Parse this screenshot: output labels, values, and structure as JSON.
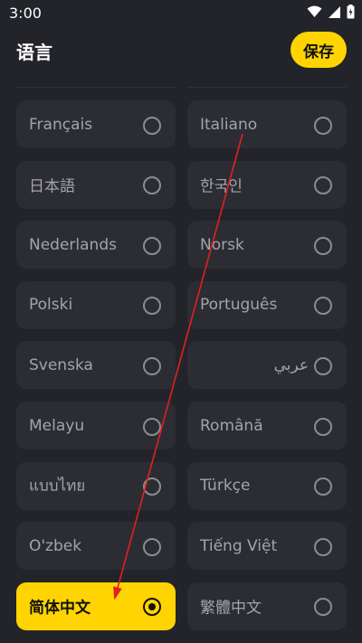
{
  "status_bar": {
    "time": "3:00",
    "icons": [
      "wifi-icon",
      "signal-icon",
      "battery-icon"
    ]
  },
  "header": {
    "title": "语言",
    "save_label": "保存"
  },
  "colors": {
    "background": "#232429",
    "item_background": "#2c2d33",
    "accent": "#ffd400",
    "annotation_arrow": "#e02020"
  },
  "languages": [
    {
      "label": "Français",
      "selected": false
    },
    {
      "label": "Italiano",
      "selected": false
    },
    {
      "label": "日本語",
      "selected": false
    },
    {
      "label": "한국인",
      "selected": false
    },
    {
      "label": "Nederlands",
      "selected": false
    },
    {
      "label": "Norsk",
      "selected": false
    },
    {
      "label": "Polski",
      "selected": false
    },
    {
      "label": "Português",
      "selected": false
    },
    {
      "label": "Svenska",
      "selected": false
    },
    {
      "label": "عربي",
      "selected": false
    },
    {
      "label": "Melayu",
      "selected": false
    },
    {
      "label": "Română",
      "selected": false
    },
    {
      "label": "แบบไทย",
      "selected": false
    },
    {
      "label": "Türkçe",
      "selected": false
    },
    {
      "label": "O'zbek",
      "selected": false
    },
    {
      "label": "Tiếng Việt",
      "selected": false
    },
    {
      "label": "简体中文",
      "selected": true
    },
    {
      "label": "繁體中文",
      "selected": false
    }
  ]
}
